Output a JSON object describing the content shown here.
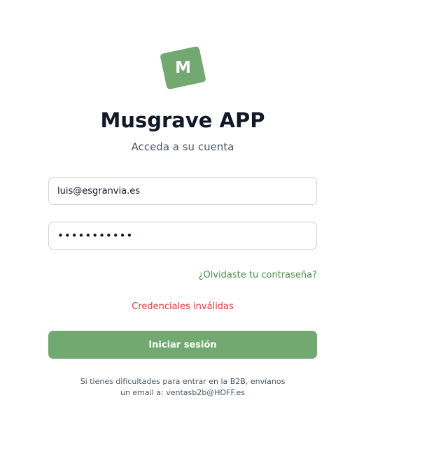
{
  "logo": {
    "letter": "M",
    "color": "#72a970"
  },
  "header": {
    "title": "Musgrave APP",
    "subtitle": "Acceda a su cuenta"
  },
  "form": {
    "email_value": "luis@esgranvia.es",
    "password_mask": "•••••••••••",
    "forgot_link": "¿Olvidaste tu contraseña?",
    "error_message": "Credenciales inválidas",
    "submit_label": "Iniciar sesión"
  },
  "help": {
    "line1": "Si tienes dificultades para entrar en la B2B, envíanos",
    "line2": "un email a: ventasb2b@HOFF.es"
  },
  "colors": {
    "accent": "#72a970",
    "link": "#4b8f46",
    "error": "#dc3b3b",
    "title": "#111827"
  }
}
